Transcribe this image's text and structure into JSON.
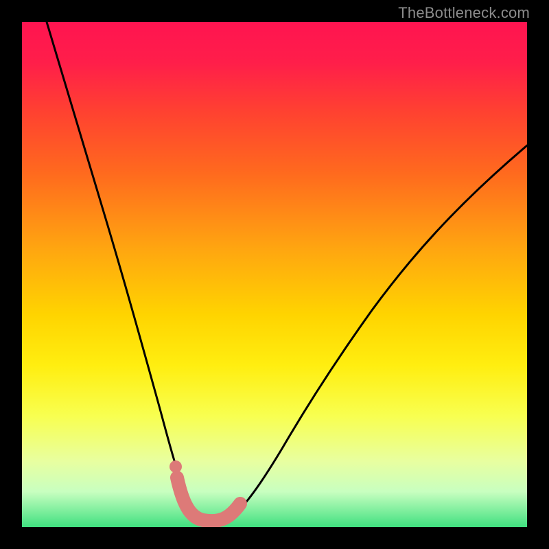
{
  "watermark": "TheBottleneck.com",
  "colors": {
    "frame": "#000000",
    "watermark_text": "#8c8c8c",
    "curve_stroke": "#000000",
    "marker": "#dd7a78",
    "gradient_top": "#ff1450",
    "gradient_bottom": "#40e080"
  },
  "chart_data": {
    "type": "line",
    "title": "",
    "xlabel": "",
    "ylabel": "",
    "xlim": [
      0,
      100
    ],
    "ylim": [
      0,
      100
    ],
    "grid": false,
    "legend": false,
    "series": [
      {
        "name": "bottleneck-curve",
        "x": [
          5,
          8,
          11,
          14,
          17,
          20,
          23,
          26,
          28.5,
          31,
          33,
          35,
          37,
          40,
          43,
          47,
          52,
          58,
          66,
          76,
          88,
          100
        ],
        "y": [
          100,
          89,
          79,
          69,
          59,
          50,
          41,
          32,
          24,
          16,
          10,
          5,
          2,
          2,
          4,
          9,
          16,
          24,
          34,
          46,
          58,
          70
        ],
        "note": "y is approximate bottleneck percentage read visually from curve; minimum near x≈38"
      }
    ],
    "annotations": [
      {
        "name": "optimal-region",
        "kind": "valley-highlight",
        "x_range": [
          31,
          44
        ],
        "y": 2,
        "note": "pink U-shaped marker and dot indicating optimal/minimum-bottleneck region"
      }
    ]
  }
}
